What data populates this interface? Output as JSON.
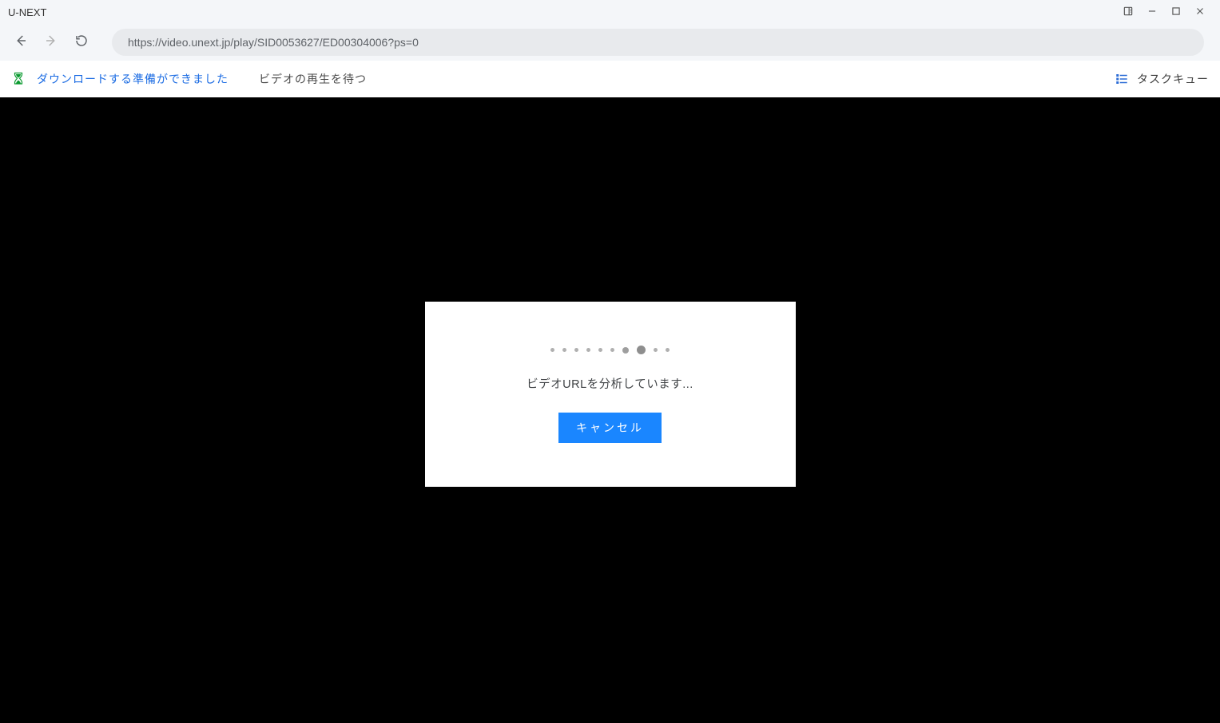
{
  "window": {
    "title": "U-NEXT"
  },
  "nav": {
    "url": "https://video.unext.jp/play/SID0053627/ED00304006?ps=0"
  },
  "status": {
    "ready_text": "ダウンロードする準備ができました",
    "waiting_text": "ビデオの再生を待つ",
    "task_queue_label": "タスクキュー"
  },
  "modal": {
    "message": "ビデオURLを分析しています...",
    "cancel_label": "キャンセル"
  },
  "colors": {
    "accent": "#1a86ff",
    "link": "#1a6be3",
    "hourglass": "#0a9a2f",
    "content_bg": "#000000"
  },
  "icons": {
    "panel": "panel-icon",
    "minimize": "minimize-icon",
    "maximize": "maximize-icon",
    "close": "close-icon",
    "back": "back-icon",
    "forward": "forward-icon",
    "reload": "reload-icon",
    "hourglass": "hourglass-icon",
    "queue": "queue-icon"
  }
}
